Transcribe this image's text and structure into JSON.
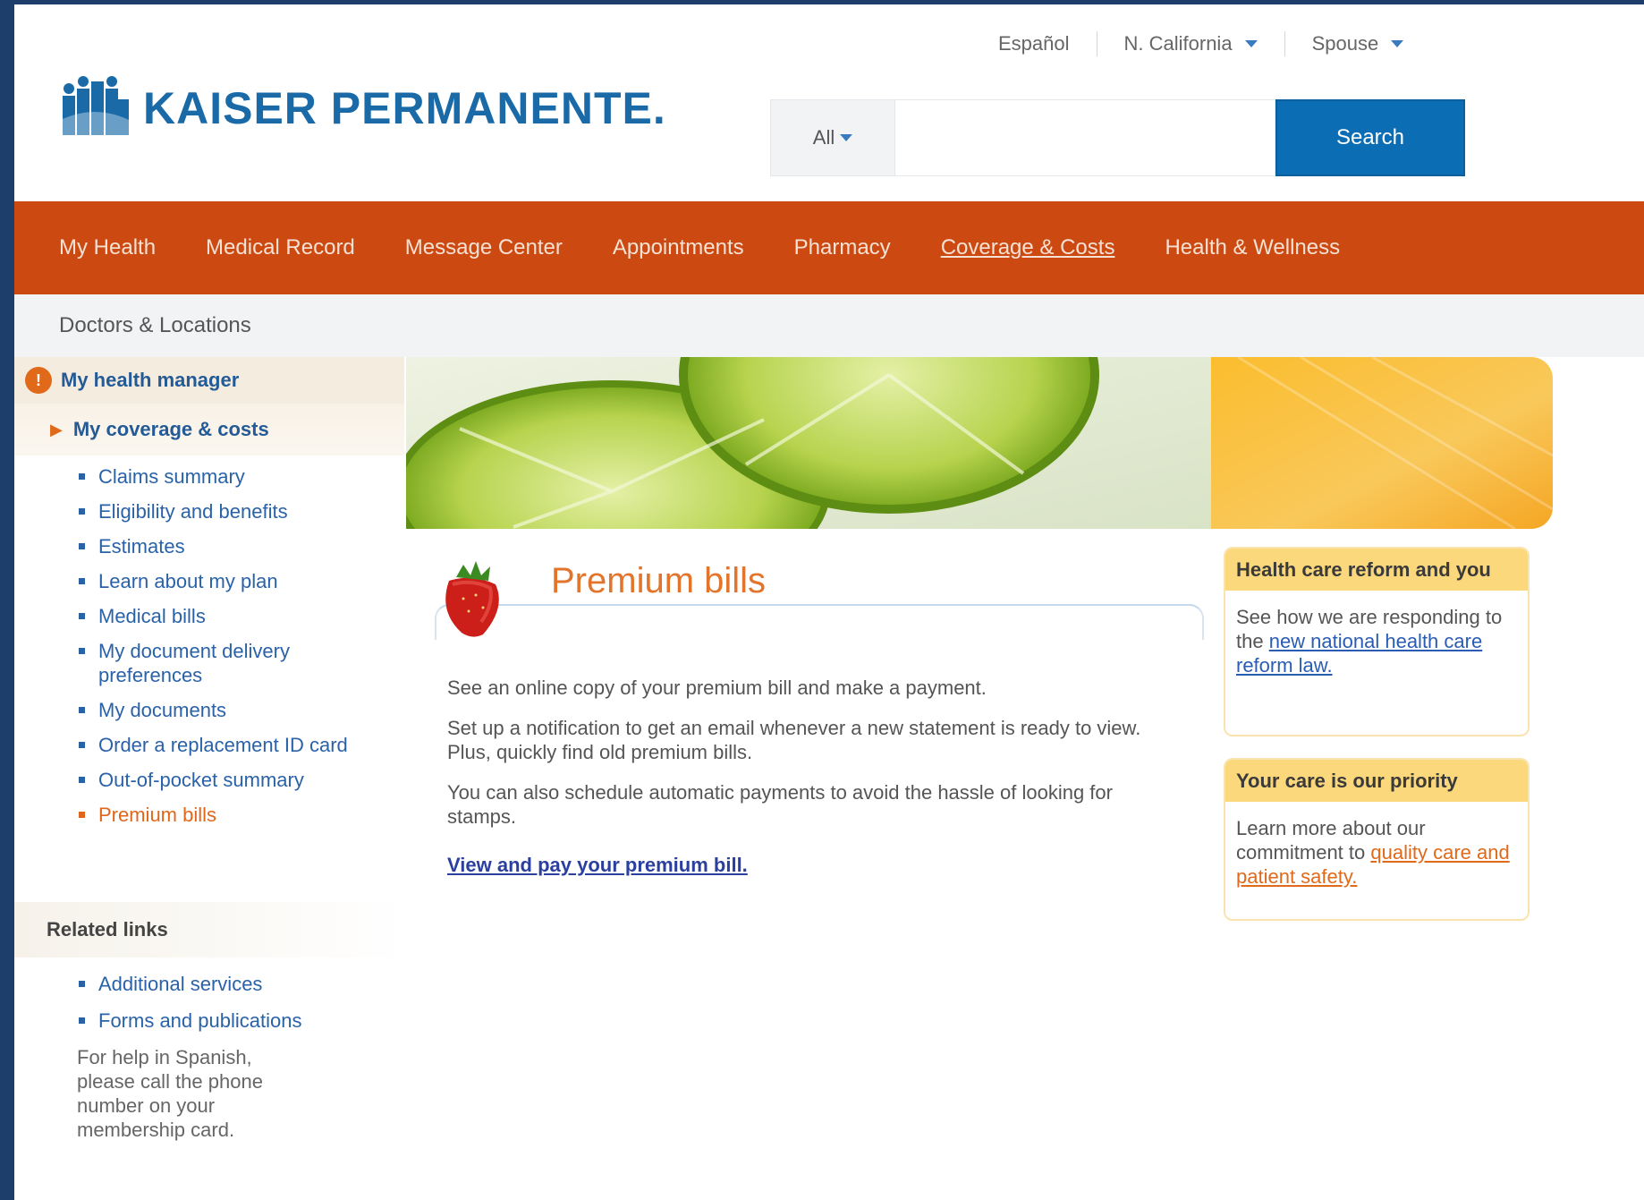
{
  "utility": {
    "language_label": "Español",
    "region_label": "N. California",
    "user_label": "Spouse"
  },
  "logo": {
    "text": "KAISER PERMANENTE."
  },
  "search": {
    "scope_label": "All",
    "placeholder": "",
    "button_label": "Search"
  },
  "nav": {
    "items": [
      "My Health",
      "Medical Record",
      "Message Center",
      "Appointments",
      "Pharmacy",
      "Coverage & Costs",
      "Health & Wellness"
    ]
  },
  "subbar": {
    "label": "Doctors & Locations"
  },
  "sidebar": {
    "top_label": "My health manager",
    "top_badge": "!",
    "section_label": "My coverage & costs",
    "items": [
      "Claims summary",
      "Eligibility and benefits",
      "Estimates",
      "Learn about my plan",
      "Medical bills",
      "My document delivery preferences",
      "My documents",
      "Order a replacement ID card",
      "Out-of-pocket summary",
      "Premium bills"
    ],
    "related_label": "Related links",
    "related_items": [
      "Additional services",
      "Forms and publications"
    ],
    "related_note": "For help in Spanish, please call the phone number on your membership card."
  },
  "main": {
    "title": "Premium bills",
    "paragraphs": [
      "See an online copy of your premium bill and make a payment.",
      "Set up a notification to get an email whenever a new statement is ready to view. Plus, quickly find old premium bills.",
      "You can also schedule automatic payments to avoid the hassle of looking for stamps."
    ],
    "link_label": "View and pay your premium bill."
  },
  "boxes": {
    "reform": {
      "head": "Health care reform and you",
      "body_text": "See how we are responding to the ",
      "link": "new national health care reform law."
    },
    "priority": {
      "head": "Your care is our priority",
      "body_text": "Learn more about our commitment to ",
      "link": "quality care and patient safety."
    }
  },
  "colors": {
    "nav": "#cc4a12",
    "brand_blue": "#1a6aa8",
    "search_button": "#0b6db4",
    "title_orange": "#e2742c",
    "box_head": "#fcd87c"
  }
}
